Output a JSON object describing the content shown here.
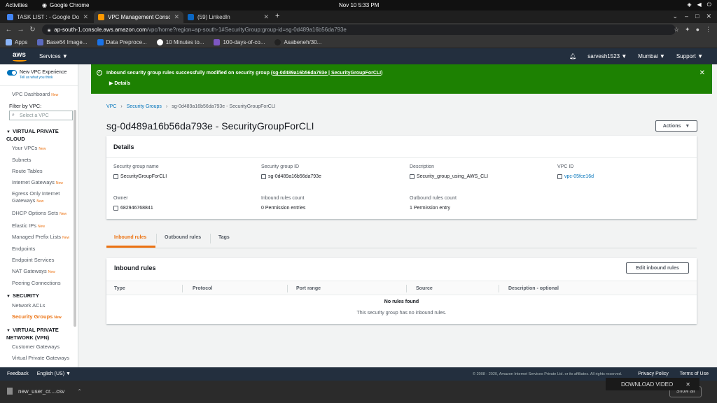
{
  "os": {
    "activities": "Activities",
    "app_name": "Google Chrome",
    "clock": "Nov 10  5:33 PM"
  },
  "browser": {
    "tabs": [
      {
        "title": "TASK LIST : - Google Docs",
        "color": "#4285f4"
      },
      {
        "title": "VPC Management Console",
        "color": "#ff9900"
      },
      {
        "title": "(59) LinkedIn",
        "color": "#0a66c2"
      }
    ],
    "url_host": "ap-south-1.console.aws.amazon.com",
    "url_path": "/vpc/home?region=ap-south-1#SecurityGroup:group-id=sg-0d489a16b56da793e",
    "bookmarks": [
      {
        "label": "Apps",
        "color": "#8ab4f8"
      },
      {
        "label": "Base64 Image...",
        "color": "#5c6bc0"
      },
      {
        "label": "Data Preproce...",
        "color": "#1a73e8"
      },
      {
        "label": "10 Minutes to...",
        "color": "#ffffff"
      },
      {
        "label": "100-days-of-co...",
        "color": "#7e57c2"
      },
      {
        "label": "Asabeneh/30...",
        "color": "#222222"
      }
    ]
  },
  "aws_header": {
    "logo": "aws",
    "services": "Services ▼",
    "user": "sarvesh1523 ▼",
    "region": "Mumbai ▼",
    "support": "Support ▼"
  },
  "sidebar": {
    "new_vpc_experience": "New VPC Experience",
    "tell_us": "Tell us what you think",
    "dashboard": "VPC Dashboard",
    "new": "New",
    "filter_label": "Filter by VPC:",
    "filter_placeholder": "Select a VPC",
    "section_vpc": "VIRTUAL PRIVATE CLOUD",
    "your_vpcs": "Your VPCs",
    "subnets": "Subnets",
    "route_tables": "Route Tables",
    "internet_gateways": "Internet Gateways",
    "egress_gateways": "Egress Only Internet Gateways",
    "dhcp": "DHCP Options Sets",
    "elastic_ips": "Elastic IPs",
    "prefix_lists": "Managed Prefix Lists",
    "endpoints": "Endpoints",
    "endpoint_services": "Endpoint Services",
    "nat": "NAT Gateways",
    "peering": "Peering Connections",
    "section_security": "SECURITY",
    "nacls": "Network ACLs",
    "security_groups": "Security Groups",
    "section_vpn": "VIRTUAL PRIVATE NETWORK (VPN)",
    "customer_gw": "Customer Gateways",
    "vpg": "Virtual Private Gateways"
  },
  "flash": {
    "message_prefix": "Inbound security group rules successfully modified on security group (",
    "message_link": "sg-0d489a16b56da793e | SecurityGroupForCLI",
    "message_suffix": ")",
    "details": "Details",
    "color": "#1d8102"
  },
  "breadcrumb": {
    "vpc": "VPC",
    "security_groups": "Security Groups",
    "current": "sg-0d489a16b56da793e - SecurityGroupForCLI"
  },
  "page_title": "sg-0d489a16b56da793e - SecurityGroupForCLI",
  "actions": "Actions",
  "details": {
    "heading": "Details",
    "sg_name_label": "Security group name",
    "sg_name": "SecurityGroupForCLI",
    "sg_id_label": "Security group ID",
    "sg_id": "sg-0d489a16b56da793e",
    "desc_label": "Description",
    "desc": "Security_group_using_AWS_CLI",
    "vpc_label": "VPC ID",
    "vpc": "vpc-05fce16d",
    "owner_label": "Owner",
    "owner": "682946768841",
    "inbound_count_label": "Inbound rules count",
    "inbound_count": "0 Permission entries",
    "outbound_count_label": "Outbound rules count",
    "outbound_count": "1 Permission entry"
  },
  "tabs": {
    "inbound": "Inbound rules",
    "outbound": "Outbound rules",
    "tags": "Tags"
  },
  "inbound_rules": {
    "title": "Inbound rules",
    "edit": "Edit inbound rules",
    "columns": [
      "Type",
      "Protocol",
      "Port range",
      "Source",
      "Description - optional"
    ],
    "empty_title": "No rules found",
    "empty_text": "This security group has no inbound rules."
  },
  "footer": {
    "feedback": "Feedback",
    "language": "English (US) ▼",
    "copyright": "© 2008 - 2020, Amazon Internet Services Private Ltd. or its affiliates. All rights reserved.",
    "privacy": "Privacy Policy",
    "terms": "Terms of Use"
  },
  "downloads": {
    "file": "new_user_cr....csv",
    "show_all": "Show all",
    "download_video": "DOWNLOAD VIDEO"
  }
}
